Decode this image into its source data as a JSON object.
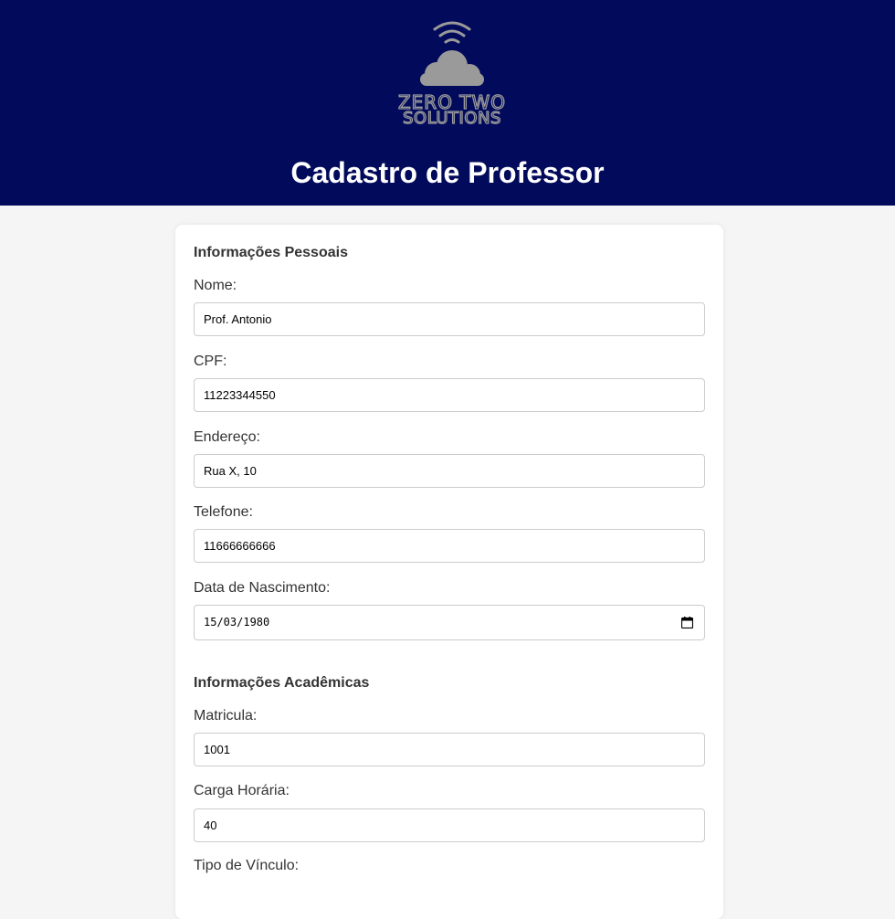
{
  "header": {
    "brand_line1": "ZERO TWO",
    "brand_line2": "SOLUTIONS",
    "title": "Cadastro de Professor"
  },
  "personal": {
    "section_title": "Informações Pessoais",
    "nome": {
      "label": "Nome:",
      "value": "Prof. Antonio"
    },
    "cpf": {
      "label": "CPF:",
      "value": "11223344550"
    },
    "endereco": {
      "label": "Endereço:",
      "value": "Rua X, 10"
    },
    "telefone": {
      "label": "Telefone:",
      "value": "11666666666"
    },
    "nascimento": {
      "label": "Data de Nascimento:",
      "value": "15/03/1980"
    }
  },
  "academic": {
    "section_title": "Informações Acadêmicas",
    "matricula": {
      "label": "Matricula:",
      "value": "1001"
    },
    "carga": {
      "label": "Carga Horária:",
      "value": "40"
    },
    "vinculo": {
      "label": "Tipo de Vínculo:"
    }
  },
  "colors": {
    "header_bg": "#020b5b",
    "logo_gray": "#9a9a9a"
  }
}
